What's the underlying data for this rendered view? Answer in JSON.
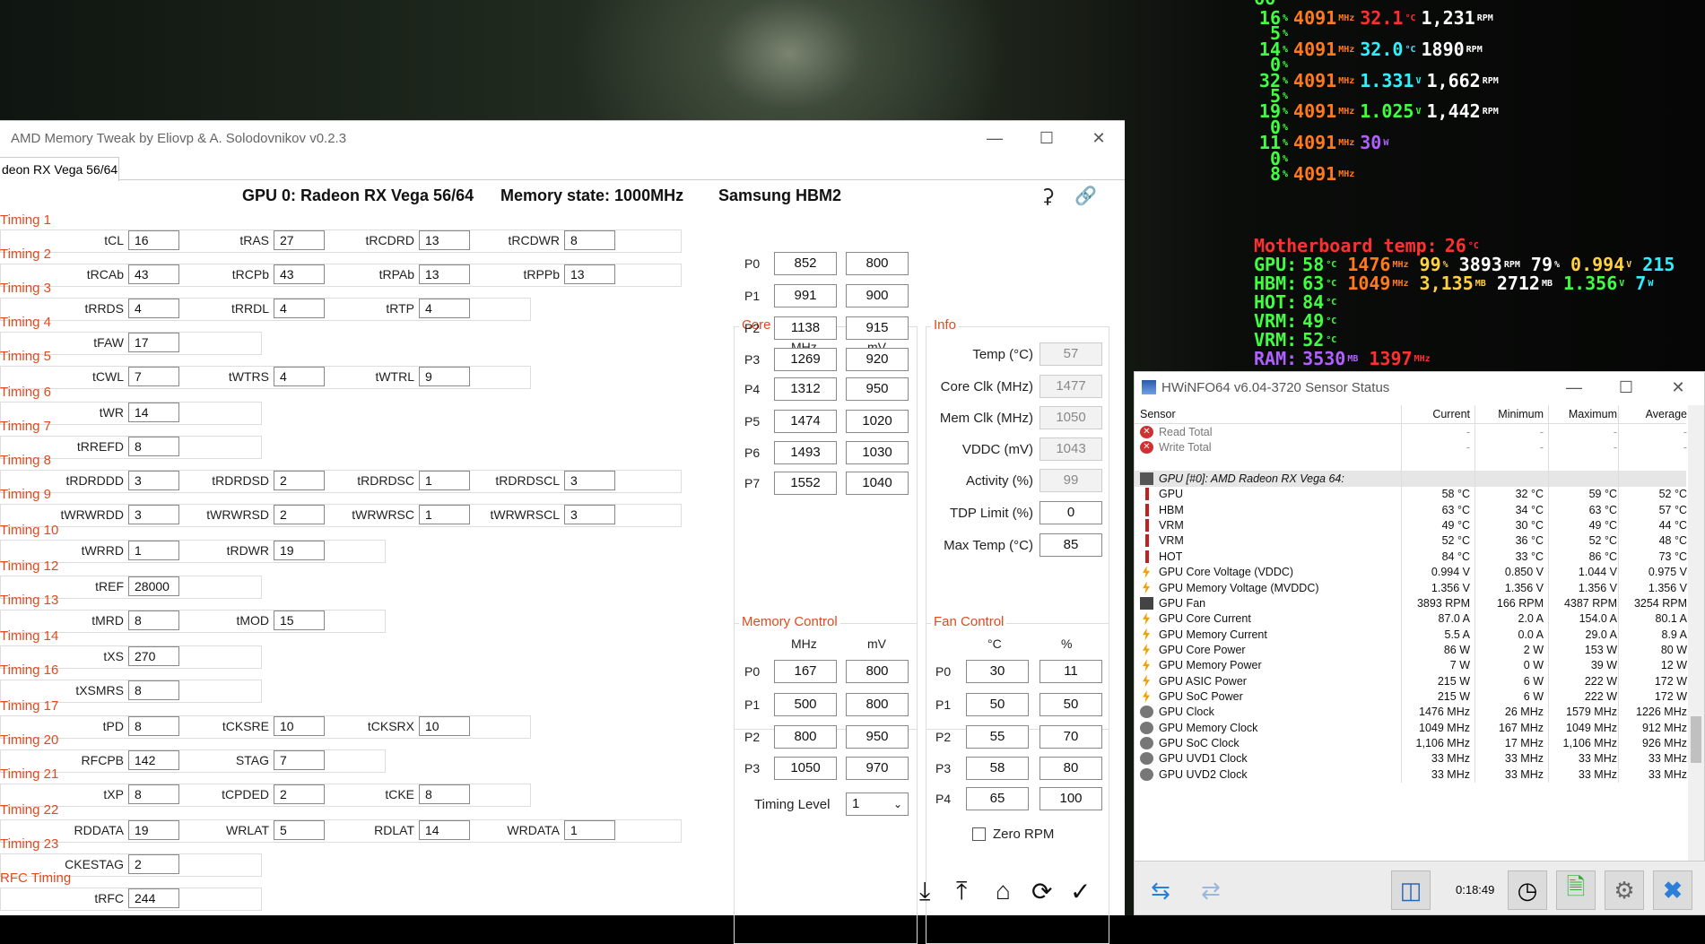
{
  "osd": {
    "top_partial": "66",
    "rows": [
      {
        "a": "16",
        "b": "4091",
        "c": "32.1",
        "cu": "°C",
        "d": "1,231",
        "du": "RPM",
        "ccls": "r",
        "dcls": "w"
      },
      {
        "a": "5"
      },
      {
        "a": "14",
        "b": "4091",
        "c": "32.0",
        "cu": "°C",
        "d": "1890",
        "du": "RPM",
        "ccls": "c",
        "dcls": "w"
      },
      {
        "a": "0"
      },
      {
        "a": "32",
        "b": "4091",
        "c": "1.331",
        "cu": "V",
        "d": "1,662",
        "du": "RPM",
        "ccls": "c",
        "dcls": "w"
      },
      {
        "a": "5"
      },
      {
        "a": "19",
        "b": "4091",
        "c": "1.025",
        "cu": "V",
        "d": "1,442",
        "du": "RPM",
        "ccls": "g",
        "dcls": "w"
      },
      {
        "a": "0"
      },
      {
        "a": "11",
        "b": "4091",
        "c": "30",
        "cu": "W",
        "ccls": "m"
      },
      {
        "a": "0"
      },
      {
        "a": "8",
        "b": "4091"
      }
    ],
    "mb_temp": "Motherboard temp:",
    "mb_val": "26",
    "mb_unit": "°C",
    "gpu": {
      "label": "GPU:",
      "t": "58",
      "tu": "°C",
      "clk": "1476",
      "clku": "MHz",
      "load": "99",
      "loadu": "%",
      "fan": "3893",
      "fanu": "RPM",
      "x": "79",
      "xu": "%",
      "v": "0.994",
      "vu": "V",
      "p": "215"
    },
    "hbm": {
      "label": "HBM:",
      "t": "63",
      "tu": "°C",
      "clk": "1049",
      "clku": "MHz",
      "mem": "3,135",
      "memu": "MB",
      "m2": "2712",
      "m2u": "MB",
      "v": "1.356",
      "vu": "V",
      "w": "7",
      "wu": "W"
    },
    "hot": {
      "label": "HOT:",
      "t": "84",
      "tu": "°C"
    },
    "vrm1": {
      "label": "VRM:",
      "t": "49",
      "tu": "°C"
    },
    "vrm2": {
      "label": "VRM:",
      "t": "52",
      "tu": "°C"
    },
    "ram": {
      "label": "RAM:",
      "v": "3530",
      "vu": "MB",
      "c": "1397",
      "cu": "MHz"
    },
    "pct": "%",
    "mhz": "MHz"
  },
  "amt": {
    "title": "AMD Memory Tweak by Eliovp & A. Solodovnikov v0.2.3",
    "tab": "deon RX Vega 56/64",
    "gpu": "GPU 0: Radeon RX Vega 56/64",
    "memstate": "Memory state: 1000MHz",
    "memtype": "Samsung HBM2",
    "timings": [
      {
        "name": "Timing 1",
        "f": [
          [
            "tCL",
            "16"
          ],
          [
            "tRAS",
            "27"
          ],
          [
            "tRCDRD",
            "13"
          ],
          [
            "tRCDWR",
            "8"
          ]
        ]
      },
      {
        "name": "Timing 2",
        "f": [
          [
            "tRCAb",
            "43"
          ],
          [
            "tRCPb",
            "43"
          ],
          [
            "tRPAb",
            "13"
          ],
          [
            "tRPPb",
            "13"
          ]
        ]
      },
      {
        "name": "Timing 3",
        "f": [
          [
            "tRRDS",
            "4"
          ],
          [
            "tRRDL",
            "4"
          ],
          [
            "tRTP",
            "4"
          ]
        ]
      },
      {
        "name": "Timing 4",
        "f": [
          [
            "tFAW",
            "17"
          ]
        ]
      },
      {
        "name": "Timing 5",
        "f": [
          [
            "tCWL",
            "7"
          ],
          [
            "tWTRS",
            "4"
          ],
          [
            "tWTRL",
            "9"
          ]
        ]
      },
      {
        "name": "Timing 6",
        "f": [
          [
            "tWR",
            "14"
          ]
        ]
      },
      {
        "name": "Timing 7",
        "f": [
          [
            "tRREFD",
            "8"
          ]
        ]
      },
      {
        "name": "Timing 8",
        "f": [
          [
            "tRDRDDD",
            "3"
          ],
          [
            "tRDRDSD",
            "2"
          ],
          [
            "tRDRDSC",
            "1"
          ],
          [
            "tRDRDSCL",
            "3"
          ]
        ]
      },
      {
        "name": "Timing 9",
        "f": [
          [
            "tWRWRDD",
            "3"
          ],
          [
            "tWRWRSD",
            "2"
          ],
          [
            "tWRWRSC",
            "1"
          ],
          [
            "tWRWRSCL",
            "3"
          ]
        ]
      },
      {
        "name": "Timing 10",
        "f": [
          [
            "tWRRD",
            "1"
          ],
          [
            "tRDWR",
            "19"
          ]
        ]
      },
      {
        "name": "Timing 12",
        "f": [
          [
            "tREF",
            "28000"
          ]
        ]
      },
      {
        "name": "Timing 13",
        "f": [
          [
            "tMRD",
            "8"
          ],
          [
            "tMOD",
            "15"
          ]
        ]
      },
      {
        "name": "Timing 14",
        "f": [
          [
            "tXS",
            "270"
          ]
        ]
      },
      {
        "name": "Timing 16",
        "f": [
          [
            "tXSMRS",
            "8"
          ]
        ]
      },
      {
        "name": "Timing 17",
        "f": [
          [
            "tPD",
            "8"
          ],
          [
            "tCKSRE",
            "10"
          ],
          [
            "tCKSRX",
            "10"
          ]
        ]
      },
      {
        "name": "Timing 20",
        "f": [
          [
            "RFCPB",
            "142"
          ],
          [
            "STAG",
            "7"
          ]
        ]
      },
      {
        "name": "Timing 21",
        "f": [
          [
            "tXP",
            "8"
          ],
          [
            "tCPDED",
            "2"
          ],
          [
            "tCKE",
            "8"
          ]
        ]
      },
      {
        "name": "Timing 22",
        "f": [
          [
            "RDDATA",
            "19"
          ],
          [
            "WRLAT",
            "5"
          ],
          [
            "RDLAT",
            "14"
          ],
          [
            "WRDATA",
            "1"
          ]
        ]
      },
      {
        "name": "Timing 23",
        "f": [
          [
            "CKESTAG",
            "2"
          ]
        ]
      },
      {
        "name": "RFC Timing",
        "f": [
          [
            "tRFC",
            "244"
          ]
        ]
      }
    ],
    "core": {
      "title": "Core Control",
      "h1": "MHz",
      "h2": "mV",
      "rows": [
        [
          "P0",
          "852",
          "800"
        ],
        [
          "P1",
          "991",
          "900"
        ],
        [
          "P2",
          "1138",
          "915"
        ],
        [
          "P3",
          "1269",
          "920"
        ],
        [
          "P4",
          "1312",
          "950"
        ],
        [
          "P5",
          "1474",
          "1020"
        ],
        [
          "P6",
          "1493",
          "1030"
        ],
        [
          "P7",
          "1552",
          "1040"
        ]
      ]
    },
    "info": {
      "title": "Info",
      "rows": [
        [
          "Temp (°C)",
          "57",
          true
        ],
        [
          "Core Clk (MHz)",
          "1477",
          true
        ],
        [
          "Mem Clk (MHz)",
          "1050",
          true
        ],
        [
          "VDDC (mV)",
          "1043",
          true
        ],
        [
          "Activity (%)",
          "99",
          true
        ],
        [
          "TDP Limit (%)",
          "0",
          false
        ],
        [
          "Max Temp (°C)",
          "85",
          false
        ]
      ]
    },
    "mem": {
      "title": "Memory Control",
      "h1": "MHz",
      "h2": "mV",
      "rows": [
        [
          "P0",
          "167",
          "800"
        ],
        [
          "P1",
          "500",
          "800"
        ],
        [
          "P2",
          "800",
          "950"
        ],
        [
          "P3",
          "1050",
          "970"
        ]
      ],
      "tl_label": "Timing Level",
      "tl_value": "1"
    },
    "fan": {
      "title": "Fan Control",
      "h1": "°C",
      "h2": "%",
      "rows": [
        [
          "P0",
          "30",
          "11"
        ],
        [
          "P1",
          "50",
          "50"
        ],
        [
          "P2",
          "55",
          "70"
        ],
        [
          "P3",
          "58",
          "80"
        ],
        [
          "P4",
          "65",
          "100"
        ]
      ],
      "zero": "Zero RPM"
    }
  },
  "hw": {
    "title": "HWiNFO64 v6.04-3720 Sensor Status",
    "cols": [
      "Sensor",
      "Current",
      "Minimum",
      "Maximum",
      "Average"
    ],
    "rows": [
      {
        "i": "x",
        "n": "Read Total",
        "v": [
          "-",
          "-",
          "-",
          "-"
        ]
      },
      {
        "i": "x",
        "n": "Write Total",
        "v": [
          "-",
          "-",
          "-",
          "-"
        ]
      },
      {
        "i": "",
        "n": "",
        "v": [
          "",
          "",
          "",
          ""
        ]
      },
      {
        "i": "g",
        "n": "GPU [#0]: AMD Radeon RX Vega 64:",
        "v": [
          "",
          "",
          "",
          ""
        ],
        "grp": true
      },
      {
        "i": "t",
        "n": "GPU",
        "v": [
          "58 °C",
          "32 °C",
          "59 °C",
          "52 °C"
        ]
      },
      {
        "i": "t",
        "n": "HBM",
        "v": [
          "63 °C",
          "34 °C",
          "63 °C",
          "57 °C"
        ]
      },
      {
        "i": "t",
        "n": "VRM",
        "v": [
          "49 °C",
          "30 °C",
          "49 °C",
          "44 °C"
        ]
      },
      {
        "i": "t",
        "n": "VRM",
        "v": [
          "52 °C",
          "36 °C",
          "52 °C",
          "48 °C"
        ]
      },
      {
        "i": "t",
        "n": "HOT",
        "v": [
          "84 °C",
          "33 °C",
          "86 °C",
          "73 °C"
        ]
      },
      {
        "i": "b",
        "n": "GPU Core Voltage (VDDC)",
        "v": [
          "0.994 V",
          "0.850 V",
          "1.044 V",
          "0.975 V"
        ]
      },
      {
        "i": "b",
        "n": "GPU Memory Voltage (MVDDC)",
        "v": [
          "1.356 V",
          "1.356 V",
          "1.356 V",
          "1.356 V"
        ]
      },
      {
        "i": "f",
        "n": "GPU Fan",
        "v": [
          "3893 RPM",
          "166 RPM",
          "4387 RPM",
          "3254 RPM"
        ]
      },
      {
        "i": "b",
        "n": "GPU Core Current",
        "v": [
          "87.0 A",
          "2.0 A",
          "154.0 A",
          "80.1 A"
        ]
      },
      {
        "i": "b",
        "n": "GPU Memory Current",
        "v": [
          "5.5 A",
          "0.0 A",
          "29.0 A",
          "8.9 A"
        ]
      },
      {
        "i": "b",
        "n": "GPU Core Power",
        "v": [
          "86 W",
          "2 W",
          "153 W",
          "80 W"
        ]
      },
      {
        "i": "b",
        "n": "GPU Memory Power",
        "v": [
          "7 W",
          "0 W",
          "39 W",
          "12 W"
        ]
      },
      {
        "i": "b",
        "n": "GPU ASIC Power",
        "v": [
          "215 W",
          "6 W",
          "222 W",
          "172 W"
        ]
      },
      {
        "i": "b",
        "n": "GPU SoC Power",
        "v": [
          "215 W",
          "6 W",
          "222 W",
          "172 W"
        ]
      },
      {
        "i": "c",
        "n": "GPU Clock",
        "v": [
          "1476 MHz",
          "26 MHz",
          "1579 MHz",
          "1226 MHz"
        ]
      },
      {
        "i": "c",
        "n": "GPU Memory Clock",
        "v": [
          "1049 MHz",
          "167 MHz",
          "1049 MHz",
          "912 MHz"
        ]
      },
      {
        "i": "c",
        "n": "GPU SoC Clock",
        "v": [
          "1,106 MHz",
          "17 MHz",
          "1,106 MHz",
          "926 MHz"
        ]
      },
      {
        "i": "c",
        "n": "GPU UVD1 Clock",
        "v": [
          "33 MHz",
          "33 MHz",
          "33 MHz",
          "33 MHz"
        ]
      },
      {
        "i": "c",
        "n": "GPU UVD2 Clock",
        "v": [
          "33 MHz",
          "33 MHz",
          "33 MHz",
          "33 MHz"
        ]
      }
    ],
    "time": "0:18:49"
  }
}
